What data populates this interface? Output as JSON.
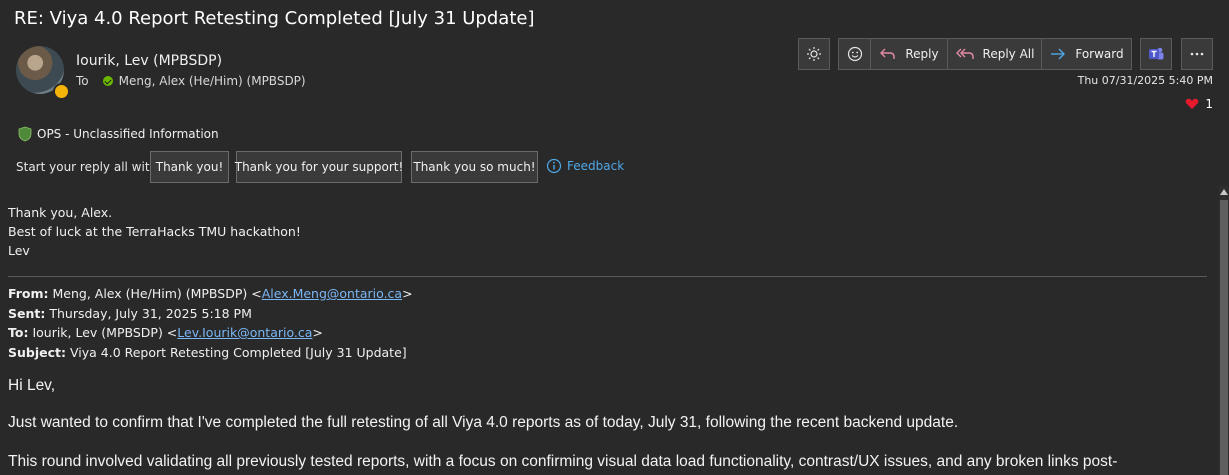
{
  "email": {
    "subject": "RE: Viya 4.0 Report Retesting Completed [July 31 Update]",
    "sender": "Iourik, Lev (MPBSDP)",
    "to_label": "To",
    "recipient": "Meng, Alex (He/Him) (MPBSDP)",
    "date": "Thu 07/31/2025 5:40 PM",
    "reaction_count": "1"
  },
  "toolbar": {
    "reply": "Reply",
    "reply_all": "Reply All",
    "forward": "Forward"
  },
  "classification": "OPS - Unclassified Information",
  "quick_reply": {
    "label": "Start your reply all with:",
    "options": [
      "Thank you!",
      "Thank you for your support!",
      "Thank you so much!"
    ],
    "feedback": "Feedback"
  },
  "body": {
    "lines": [
      "Thank you, Alex.",
      "Best of luck at the TerraHacks TMU hackathon!",
      "Lev"
    ]
  },
  "quoted": {
    "from_label": "From:",
    "from_name": "Meng, Alex (He/Him) (MPBSDP) <",
    "from_email": "Alex.Meng@ontario.ca",
    "from_end": ">",
    "sent_label": "Sent:",
    "sent_value": "Thursday, July 31, 2025 5:18 PM",
    "to_label": "To:",
    "to_name": "Iourik, Lev (MPBSDP) <",
    "to_email": "Lev.Iourik@ontario.ca",
    "to_end": ">",
    "subject_label": "Subject:",
    "subject_value": "Viya 4.0 Report Retesting Completed [July 31 Update]",
    "greeting": "Hi Lev,",
    "para1": "Just wanted to confirm that I've completed the full retesting of all Viya 4.0 reports as of today, July 31, following the recent backend update.",
    "para2": "This round involved validating all previously tested reports, with a focus on confirming visual data load functionality, contrast/UX issues, and any broken links post-"
  },
  "colors": {
    "background": "#292929",
    "reply_icon": "#e28ca3",
    "forward_icon": "#4fa8e8",
    "link": "#7ab7f5",
    "shield": "#4f8a3a",
    "presence": "#f5b40a"
  }
}
